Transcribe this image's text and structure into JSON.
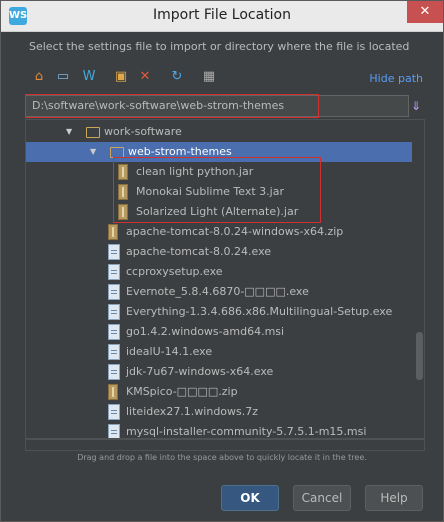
{
  "window": {
    "title": "Import File Location",
    "logo_text": "WS",
    "close_glyph": "✕"
  },
  "instructions": "Select the settings file to import or directory where the file is located",
  "toolbar": {
    "icons": [
      {
        "name": "home-icon",
        "glyph": "⌂",
        "color": "#e08a3c"
      },
      {
        "name": "desktop-icon",
        "glyph": "▭",
        "color": "#7fb0e0"
      },
      {
        "name": "webstorm-icon",
        "glyph": "W",
        "color": "#3fa8df"
      },
      {
        "name": "new-folder-icon",
        "glyph": "▣",
        "color": "#e0a84a"
      },
      {
        "name": "delete-icon",
        "glyph": "✕",
        "color": "#e05a3c"
      },
      {
        "name": "refresh-icon",
        "glyph": "↻",
        "color": "#4ea6e8"
      },
      {
        "name": "show-hidden-icon",
        "glyph": "▦",
        "color": "#aaaaaa"
      }
    ],
    "hide_path_label": "Hide path"
  },
  "path_field": {
    "value": "D:\\software\\work-software\\web-strom-themes"
  },
  "tree": {
    "rows": [
      {
        "label": "work-software",
        "type": "folder",
        "level": 0,
        "arrow": "▼",
        "selected": false
      },
      {
        "label": "web-strom-themes",
        "type": "folder",
        "level": 1,
        "arrow": "▼",
        "selected": true
      },
      {
        "label": "clean light python.jar",
        "type": "jar",
        "level": 2,
        "arrow": "",
        "selected": false
      },
      {
        "label": "Monokai Sublime Text 3.jar",
        "type": "jar",
        "level": 2,
        "arrow": "",
        "selected": false
      },
      {
        "label": "Solarized Light (Alternate).jar",
        "type": "jar",
        "level": 2,
        "arrow": "",
        "selected": false
      },
      {
        "label": "apache-tomcat-8.0.24-windows-x64.zip",
        "type": "jar",
        "level": 1,
        "arrow": "",
        "selected": false
      },
      {
        "label": "apache-tomcat-8.0.24.exe",
        "type": "file",
        "level": 1,
        "arrow": "",
        "selected": false
      },
      {
        "label": "ccproxysetup.exe",
        "type": "file",
        "level": 1,
        "arrow": "",
        "selected": false
      },
      {
        "label": "Evernote_5.8.4.6870-□□□□.exe",
        "type": "file",
        "level": 1,
        "arrow": "",
        "selected": false
      },
      {
        "label": "Everything-1.3.4.686.x86.Multilingual-Setup.exe",
        "type": "file",
        "level": 1,
        "arrow": "",
        "selected": false
      },
      {
        "label": "go1.4.2.windows-amd64.msi",
        "type": "file",
        "level": 1,
        "arrow": "",
        "selected": false
      },
      {
        "label": "idealU-14.1.exe",
        "type": "file",
        "level": 1,
        "arrow": "",
        "selected": false
      },
      {
        "label": "jdk-7u67-windows-x64.exe",
        "type": "file",
        "level": 1,
        "arrow": "",
        "selected": false
      },
      {
        "label": "KMSpico-□□□□.zip",
        "type": "jar",
        "level": 1,
        "arrow": "",
        "selected": false
      },
      {
        "label": "liteidex27.1.windows.7z",
        "type": "file",
        "level": 1,
        "arrow": "",
        "selected": false
      },
      {
        "label": "mysql-installer-community-5.7.5.1-m15.msi",
        "type": "file",
        "level": 1,
        "arrow": "",
        "selected": false
      }
    ]
  },
  "hint": "Drag and drop a file into the space above to quickly locate it in the tree.",
  "buttons": {
    "ok": "OK",
    "cancel": "Cancel",
    "help": "Help"
  }
}
